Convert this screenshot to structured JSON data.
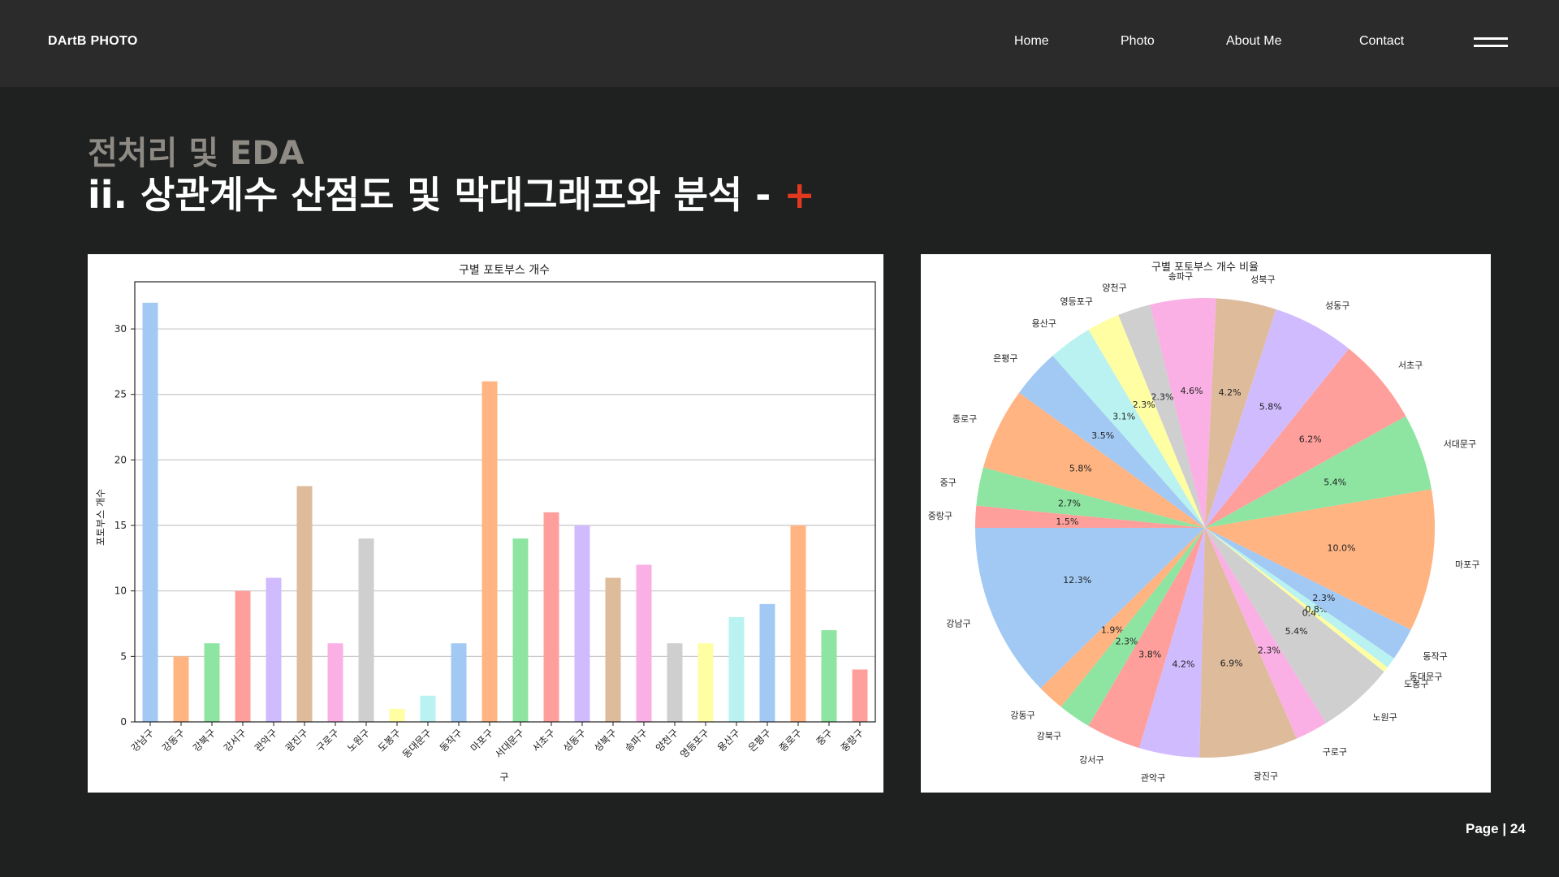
{
  "header": {
    "brand": "DArtB PHOTO",
    "nav": [
      {
        "label": "Home"
      },
      {
        "label": "Photo"
      },
      {
        "label": "About Me"
      },
      {
        "label": "Contact"
      }
    ],
    "menu_icon": "hamburger-icon"
  },
  "slide": {
    "kicker": "전처리 및 EDA",
    "title": "ii. 상관계수 산점도 및 막대그래프와 분석 -",
    "plus": "+",
    "page": "Page | 24"
  },
  "colors": {
    "accent": "#e0391f",
    "page_bg": "#1f2020",
    "topbar_bg": "#2b2b2b",
    "kicker": "#8e8a84",
    "palette": [
      "#a1c9f4",
      "#ffb482",
      "#8de5a1",
      "#ff9f9b",
      "#d0bbff",
      "#debb9b",
      "#fab0e4",
      "#cfcfcf",
      "#fffea3",
      "#b9f2f0"
    ]
  },
  "chart_data": [
    {
      "type": "bar",
      "title": "구별 포토부스 개수",
      "xlabel": "구",
      "ylabel": "포토부스 개수",
      "ylim": [
        0,
        33.6
      ],
      "yticks": [
        0,
        5,
        10,
        15,
        20,
        25,
        30
      ],
      "grid": true,
      "categories": [
        "강남구",
        "강동구",
        "강북구",
        "강서구",
        "관악구",
        "광진구",
        "구로구",
        "노원구",
        "도봉구",
        "동대문구",
        "동작구",
        "마포구",
        "서대문구",
        "서초구",
        "성동구",
        "성북구",
        "송파구",
        "양천구",
        "영등포구",
        "용산구",
        "은평구",
        "종로구",
        "중구",
        "중랑구"
      ],
      "values": [
        32,
        5,
        6,
        10,
        11,
        18,
        6,
        14,
        1,
        2,
        6,
        26,
        14,
        16,
        15,
        11,
        12,
        6,
        6,
        8,
        9,
        15,
        7,
        4
      ]
    },
    {
      "type": "pie",
      "title": "구별 포토부스 개수 비율",
      "categories": [
        "강남구",
        "강동구",
        "강북구",
        "강서구",
        "관악구",
        "광진구",
        "구로구",
        "노원구",
        "도봉구",
        "동대문구",
        "동작구",
        "마포구",
        "서대문구",
        "서초구",
        "성동구",
        "성북구",
        "송파구",
        "양천구",
        "영등포구",
        "용산구",
        "은평구",
        "종로구",
        "중구",
        "중랑구"
      ],
      "values": [
        32,
        5,
        6,
        10,
        11,
        18,
        6,
        14,
        1,
        2,
        6,
        26,
        14,
        16,
        15,
        11,
        12,
        6,
        6,
        8,
        9,
        15,
        7,
        4
      ],
      "percent_labels": [
        "12.3%",
        "1.9%",
        "2.3%",
        "3.8%",
        "4.2%",
        "6.9%",
        "2.3%",
        "5.4%",
        "0.4%",
        "0.8%",
        "2.3%",
        "10.0%",
        "5.4%",
        "6.2%",
        "5.8%",
        "4.2%",
        "4.6%",
        "2.3%",
        "2.3%",
        "3.1%",
        "3.5%",
        "5.8%",
        "2.7%",
        "1.5%"
      ]
    }
  ]
}
